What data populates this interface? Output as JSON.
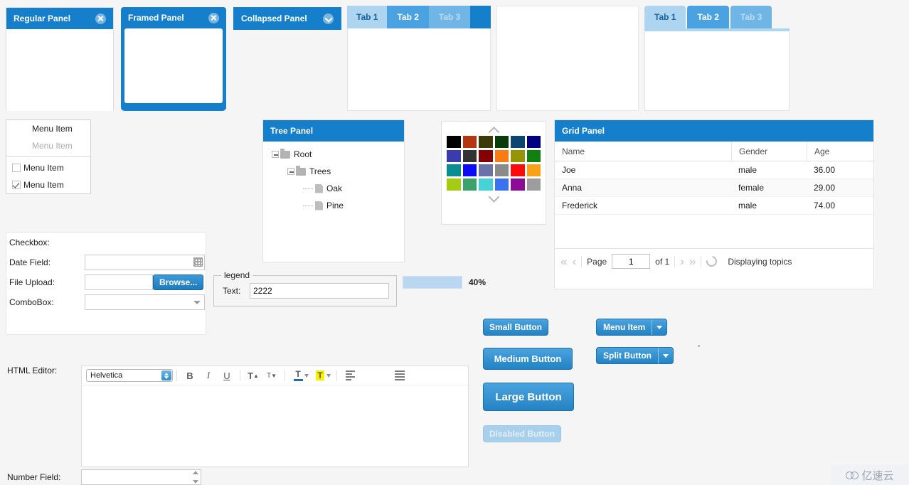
{
  "panels": {
    "regular": {
      "title": "Regular Panel",
      "tool_icon": "close-icon"
    },
    "framed": {
      "title": "Framed Panel",
      "tool_icon": "close-icon"
    },
    "collapsed": {
      "title": "Collapsed Panel",
      "tool_icon": "chevron-down-icon"
    },
    "tree": {
      "title": "Tree Panel"
    },
    "grid": {
      "title": "Grid Panel"
    }
  },
  "tabpanel1": {
    "tabs": [
      {
        "label": "Tab 1",
        "state": "active"
      },
      {
        "label": "Tab 2",
        "state": "inactive"
      },
      {
        "label": "Tab 3",
        "state": "disabled"
      }
    ]
  },
  "tabpanel2": {
    "tabs": [
      {
        "label": "Tab 1",
        "state": "active"
      },
      {
        "label": "Tab 2",
        "state": "inactive"
      },
      {
        "label": "Tab 3",
        "state": "disabled"
      }
    ]
  },
  "menu": {
    "items": [
      {
        "label": "Menu Item",
        "type": "plain",
        "state": "enabled"
      },
      {
        "label": "Menu Item",
        "type": "plain",
        "state": "disabled"
      },
      {
        "label": "Menu Item",
        "type": "checkbox",
        "checked": false
      },
      {
        "label": "Menu Item",
        "type": "checkbox",
        "checked": true
      }
    ]
  },
  "form": {
    "checkbox_label": "Checkbox:",
    "date_label": "Date Field:",
    "date_value": "",
    "date_icon": "calendar-icon",
    "file_label": "File Upload:",
    "file_value": "",
    "browse_label": "Browse...",
    "combo_label": "ComboBox:",
    "combo_value": "",
    "combo_icon": "chevron-down-icon"
  },
  "tree": {
    "nodes": [
      {
        "label": "Root",
        "depth": 0,
        "icon": "folder-icon",
        "expander": true
      },
      {
        "label": "Trees",
        "depth": 1,
        "icon": "folder-icon",
        "expander": true
      },
      {
        "label": "Oak",
        "depth": 2,
        "icon": "file-icon",
        "expander": false
      },
      {
        "label": "Pine",
        "depth": 2,
        "icon": "file-icon",
        "expander": false
      }
    ]
  },
  "colorpicker": {
    "up_icon": "chevron-up-icon",
    "down_icon": "chevron-down-icon",
    "swatches": [
      "#000000",
      "#b4350f",
      "#3d3a07",
      "#0b3b0b",
      "#0c456f",
      "#000080",
      "#3b3bb0",
      "#333333",
      "#850000",
      "#f97c13",
      "#949406",
      "#108010",
      "#0a8d91",
      "#0b0bf5",
      "#6b72aa",
      "#8a8a8a",
      "#fb0c0c",
      "#f9a218",
      "#a4cc12",
      "#3aa36b",
      "#45d3d8",
      "#3a72ef",
      "#8b0c97",
      "#9d9d9d"
    ]
  },
  "grid": {
    "columns": [
      "Name",
      "Gender",
      "Age"
    ],
    "rows": [
      {
        "name": "Joe",
        "gender": "male",
        "age": "36.00"
      },
      {
        "name": "Anna",
        "gender": "female",
        "age": "29.00"
      },
      {
        "name": "Frederick",
        "gender": "male",
        "age": "74.00"
      }
    ],
    "footer": {
      "first_icon": "double-chevron-left-icon",
      "prev_icon": "chevron-left-icon",
      "page_label": "Page",
      "page_value": "1",
      "of_label": "of 1",
      "next_icon": "chevron-right-icon",
      "last_icon": "double-chevron-right-icon",
      "refresh_icon": "refresh-icon",
      "status": "Displaying topics"
    }
  },
  "legend_box": {
    "legend": "legend",
    "text_label": "Text:",
    "text_value": "2222"
  },
  "progress": {
    "percent_label": "40%",
    "value": 40
  },
  "buttons": {
    "small": "Small Button",
    "medium": "Medium Button",
    "large": "Large Button",
    "disabled": "Disabled Button",
    "menu_item": "Menu Item",
    "split": "Split Button",
    "arrow_icon": "caret-down-icon"
  },
  "editor": {
    "label": "HTML Editor:",
    "font_value": "Helvetica",
    "bold": "B",
    "italic": "I",
    "underline": "U",
    "increase_size": "T",
    "decrease_size": "T",
    "text_color": "T",
    "highlight": "T",
    "content": "",
    "icons": {
      "font_select": "font-family-select",
      "bold": "bold-icon",
      "italic": "italic-icon",
      "underline": "underline-icon",
      "grow": "increase-font-size-icon",
      "shrink": "decrease-font-size-icon",
      "fontcolor": "font-color-icon",
      "highlight": "highlight-color-icon",
      "align": "align-left-icon",
      "list": "unordered-list-icon"
    }
  },
  "number_field": {
    "label": "Number Field:",
    "value": "",
    "spinner_icon": "spinner-icon"
  },
  "watermark": {
    "text": "亿速云",
    "icon": "cloud-logo-icon"
  },
  "theme": {
    "accent": "#157fcc",
    "tab_active_bg": "#aed5ef",
    "tab_inactive_bg": "#4aa3e0",
    "page_bg": "#f5f5f5"
  }
}
